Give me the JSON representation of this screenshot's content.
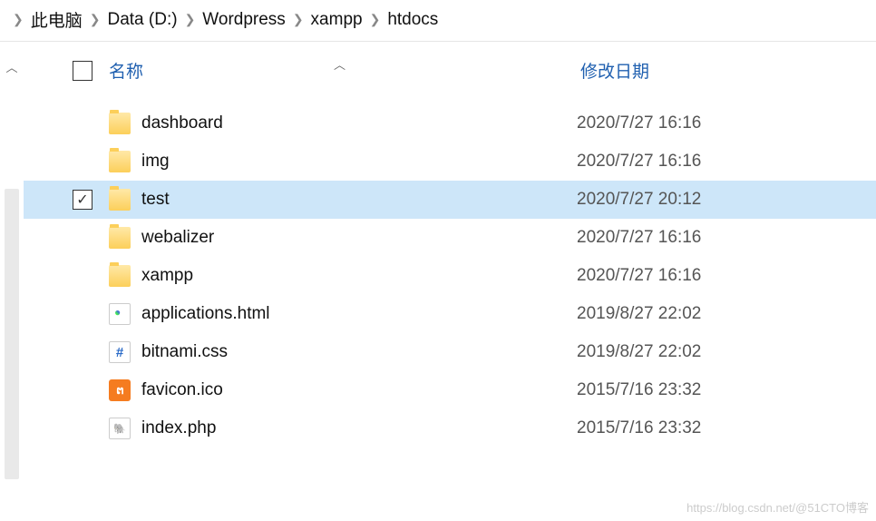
{
  "breadcrumb": [
    "此电脑",
    "Data (D:)",
    "Wordpress",
    "xampp",
    "htdocs"
  ],
  "columns": {
    "name": "名称",
    "date": "修改日期"
  },
  "files": [
    {
      "name": "dashboard",
      "date": "2020/7/27 16:16",
      "type": "folder",
      "selected": false
    },
    {
      "name": "img",
      "date": "2020/7/27 16:16",
      "type": "folder",
      "selected": false
    },
    {
      "name": "test",
      "date": "2020/7/27 20:12",
      "type": "folder",
      "selected": true
    },
    {
      "name": "webalizer",
      "date": "2020/7/27 16:16",
      "type": "folder",
      "selected": false
    },
    {
      "name": "xampp",
      "date": "2020/7/27 16:16",
      "type": "folder",
      "selected": false
    },
    {
      "name": "applications.html",
      "date": "2019/8/27 22:02",
      "type": "html",
      "selected": false
    },
    {
      "name": "bitnami.css",
      "date": "2019/8/27 22:02",
      "type": "css",
      "selected": false
    },
    {
      "name": "favicon.ico",
      "date": "2015/7/16 23:32",
      "type": "ico",
      "selected": false
    },
    {
      "name": "index.php",
      "date": "2015/7/16 23:32",
      "type": "php",
      "selected": false
    }
  ],
  "watermark": "https://blog.csdn.net/@51CTO博客"
}
